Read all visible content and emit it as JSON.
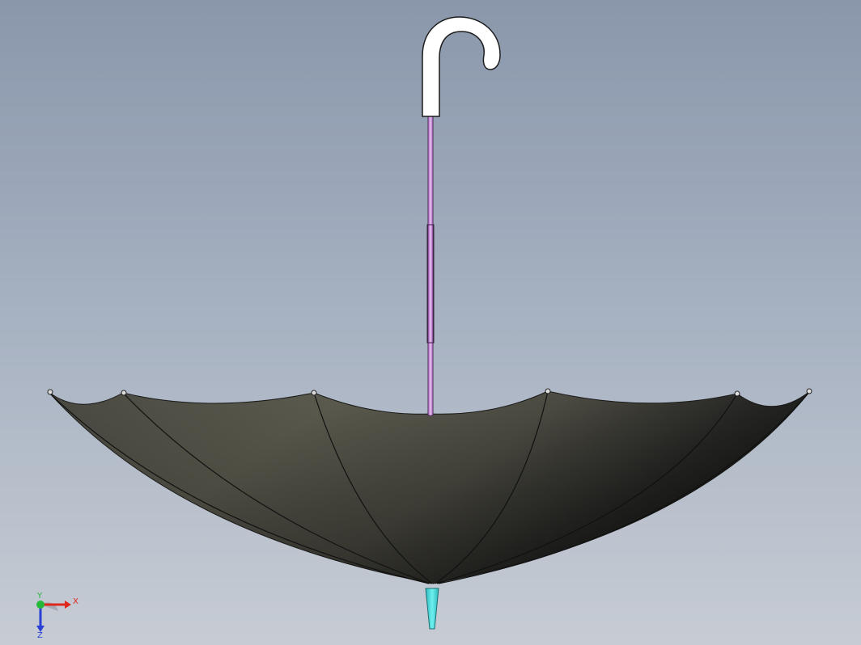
{
  "viewport": {
    "model": "umbrella",
    "colors": {
      "background_top": "#8a97ab",
      "background_bottom": "#c7ccd4",
      "canopy_light": "#5d5c50",
      "canopy_dark": "#1e1e1c",
      "handle": "#ffffff",
      "shaft": "#c78bd6",
      "tip": "#3fd6d9"
    }
  },
  "triad": {
    "x_label": "X",
    "y_label": "Y",
    "z_label": "Z",
    "colors": {
      "x": "#e0271b",
      "y": "#25b83a",
      "z": "#2a3fd6"
    }
  }
}
